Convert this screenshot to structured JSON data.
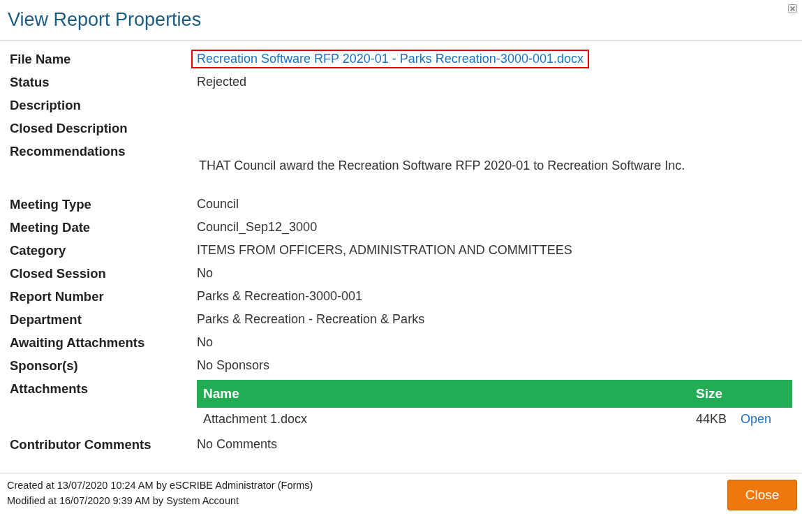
{
  "dialog": {
    "title": "View Report Properties"
  },
  "properties": [
    {
      "kind": "link",
      "label": "File Name",
      "value": "Recreation Software RFP 2020-01 - Parks Recreation-3000-001.docx",
      "highlighted": true
    },
    {
      "kind": "text",
      "label": "Status",
      "value": "Rejected"
    },
    {
      "kind": "text",
      "label": "Description"
    },
    {
      "kind": "text",
      "label": "Closed Description"
    },
    {
      "kind": "paragraph",
      "label": "Recommendations",
      "value": "THAT Council award the Recreation Software RFP 2020-01 to Recreation Software Inc."
    },
    {
      "kind": "text",
      "label": "Meeting Type",
      "value": "Council"
    },
    {
      "kind": "text",
      "label": "Meeting Date",
      "value": "Council_Sep12_3000"
    },
    {
      "kind": "text",
      "label": "Category",
      "value": "ITEMS FROM OFFICERS, ADMINISTRATION AND COMMITTEES"
    },
    {
      "kind": "text",
      "label": "Closed Session",
      "value": "No"
    },
    {
      "kind": "text",
      "label": "Report Number",
      "value": "Parks & Recreation-3000-001"
    },
    {
      "kind": "text",
      "label": "Department",
      "value": "Parks & Recreation - Recreation & Parks"
    },
    {
      "kind": "text",
      "label": "Awaiting Attachments",
      "value": "No"
    },
    {
      "kind": "text",
      "label": "Sponsor(s)",
      "value": "No Sponsors"
    },
    {
      "kind": "table",
      "label": "Attachments",
      "columns": [
        "Name",
        "Size"
      ],
      "rows": [
        {
          "name": "Attachment 1.docx",
          "size": "44KB",
          "action": "Open"
        }
      ]
    },
    {
      "kind": "text",
      "label": "Contributor Comments",
      "value": "No Comments"
    }
  ],
  "footer": {
    "created": "Created at 13/07/2020 10:24 AM by eSCRIBE Administrator (Forms)",
    "modified": "Modified at 16/07/2020 9:39 AM by System Account",
    "button": "Close"
  }
}
